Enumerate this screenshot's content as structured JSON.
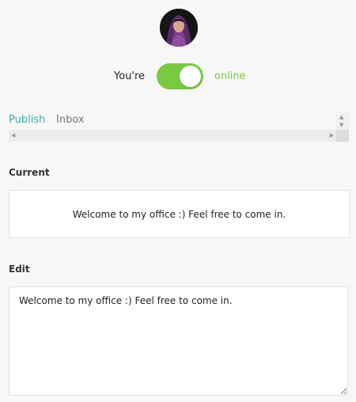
{
  "profile": {
    "avatar_alt": "profile photo"
  },
  "status": {
    "prefix": "You're",
    "value": "online",
    "is_online": true,
    "accent_color": "#7ac943"
  },
  "tabs": [
    {
      "label": "Publish",
      "active": true
    },
    {
      "label": "Inbox",
      "active": false
    }
  ],
  "scroll_icons": {
    "left": "arrow-left-icon",
    "right": "arrow-right-icon",
    "up": "arrow-up-icon",
    "down": "arrow-down-icon"
  },
  "current": {
    "label": "Current",
    "message": "Welcome to my office :) Feel free to come in."
  },
  "edit": {
    "label": "Edit",
    "value": "Welcome to my office :) Feel free to come in."
  },
  "colors": {
    "tab_active": "#3aaea3",
    "tab_inactive": "#777777",
    "toggle_on": "#7ac943"
  }
}
